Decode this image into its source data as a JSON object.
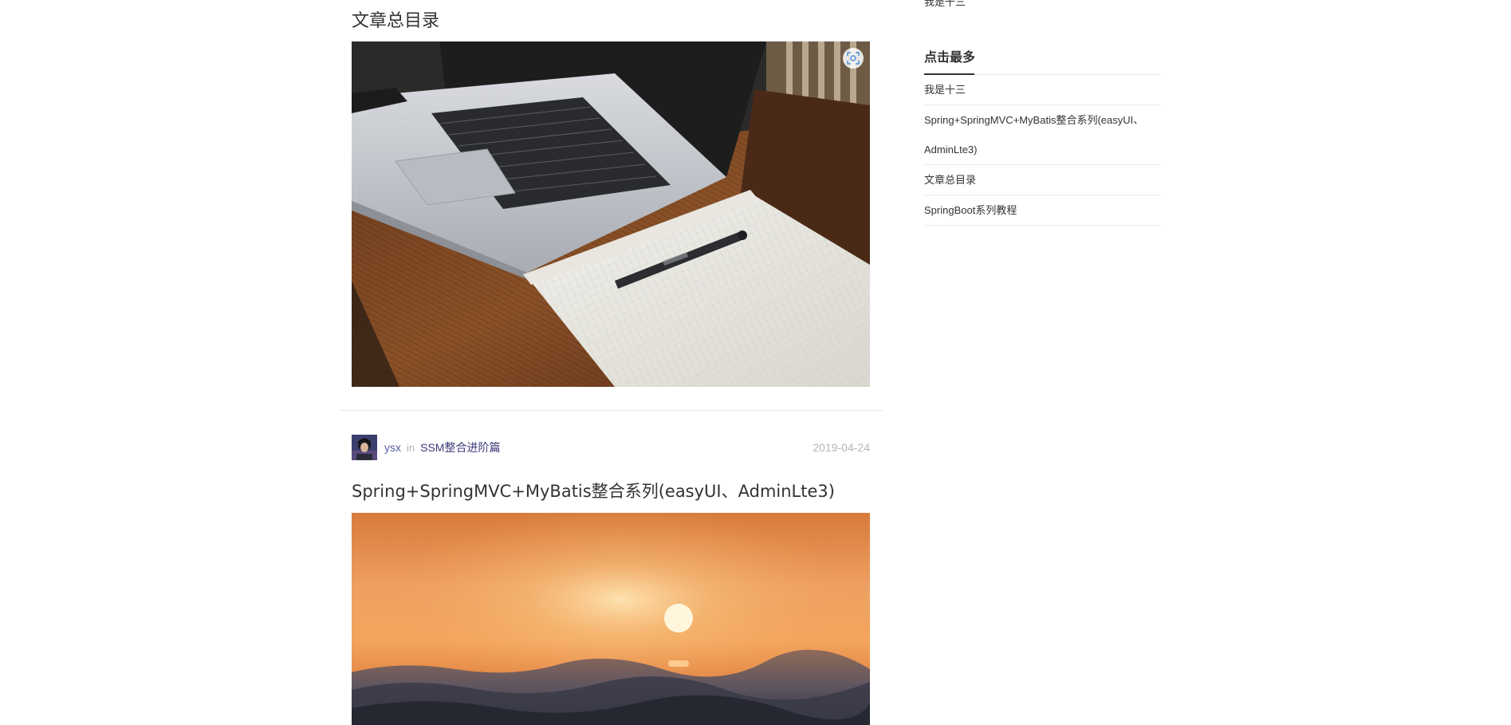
{
  "sidebar": {
    "cut_item": "我是十三",
    "widget_title": "点击最多",
    "hot_posts": [
      "我是十三",
      "Spring+SpringMVC+MyBatis整合系列(easyUI、AdminLte3)",
      "文章总目录",
      "SpringBoot系列教程"
    ]
  },
  "posts": [
    {
      "title": "文章总目录",
      "cover": "laptop-notebook-photo"
    },
    {
      "author": "ysx",
      "in_word": "in",
      "category": "SSM整合进阶篇",
      "date": "2019-04-24",
      "title": "Spring+SpringMVC+MyBatis整合系列(easyUI、AdminLte3)",
      "cover": "sunset-sea-photo"
    }
  ],
  "colors": {
    "author": "#5a5aa8",
    "category": "#3b3b7a",
    "date": "#b5b5b5",
    "divider": "#e6e6e6"
  }
}
